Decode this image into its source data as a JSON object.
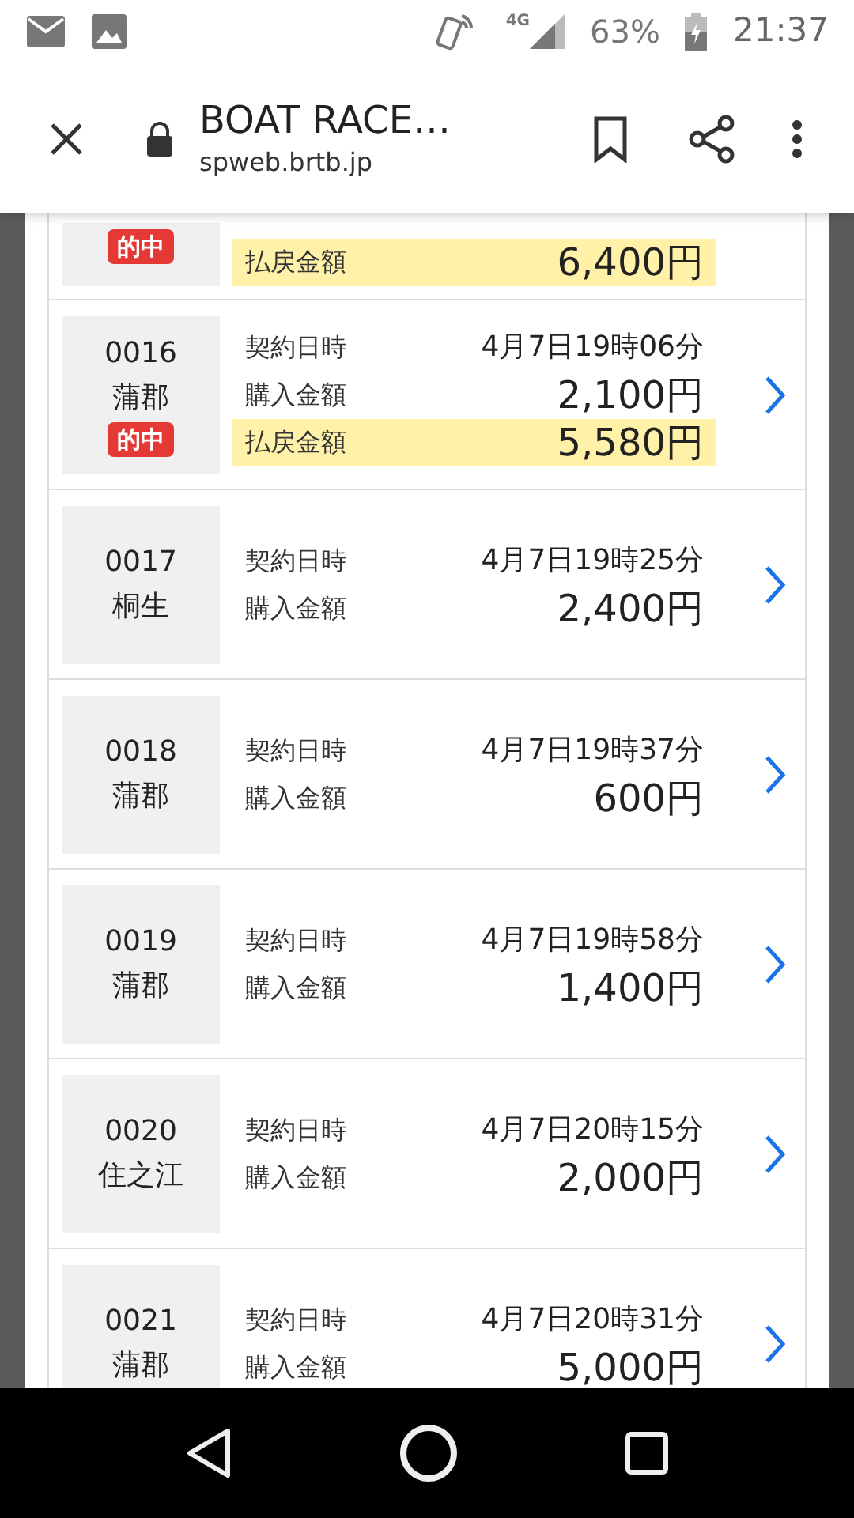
{
  "status_bar": {
    "network": "4G",
    "battery": "63%",
    "time": "21:37"
  },
  "browser": {
    "title": "BOAT RACE…",
    "url": "spweb.brtb.jp"
  },
  "cards": [
    {
      "kind": "clipped",
      "hit": true,
      "hit_label": "的中",
      "rows": [
        {
          "kind": "amount",
          "label": "払戻金額",
          "value": "6,400円",
          "highlight": true
        }
      ]
    },
    {
      "kind": "full",
      "number": "0016",
      "venue": "蒲郡",
      "hit": true,
      "hit_label": "的中",
      "rows": [
        {
          "kind": "date",
          "label": "契約日時",
          "value": "4月7日19時06分",
          "highlight": false
        },
        {
          "kind": "amount",
          "label": "購入金額",
          "value": "2,100円",
          "highlight": false
        },
        {
          "kind": "amount",
          "label": "払戻金額",
          "value": "5,580円",
          "highlight": true
        }
      ]
    },
    {
      "kind": "full",
      "number": "0017",
      "venue": "桐生",
      "hit": false,
      "rows": [
        {
          "kind": "date",
          "label": "契約日時",
          "value": "4月7日19時25分",
          "highlight": false
        },
        {
          "kind": "amount",
          "label": "購入金額",
          "value": "2,400円",
          "highlight": false
        }
      ]
    },
    {
      "kind": "full",
      "number": "0018",
      "venue": "蒲郡",
      "hit": false,
      "rows": [
        {
          "kind": "date",
          "label": "契約日時",
          "value": "4月7日19時37分",
          "highlight": false
        },
        {
          "kind": "amount",
          "label": "購入金額",
          "value": "600円",
          "highlight": false
        }
      ]
    },
    {
      "kind": "full",
      "number": "0019",
      "venue": "蒲郡",
      "hit": false,
      "rows": [
        {
          "kind": "date",
          "label": "契約日時",
          "value": "4月7日19時58分",
          "highlight": false
        },
        {
          "kind": "amount",
          "label": "購入金額",
          "value": "1,400円",
          "highlight": false
        }
      ]
    },
    {
      "kind": "full",
      "number": "0020",
      "venue": "住之江",
      "hit": false,
      "rows": [
        {
          "kind": "date",
          "label": "契約日時",
          "value": "4月7日20時15分",
          "highlight": false
        },
        {
          "kind": "amount",
          "label": "購入金額",
          "value": "2,000円",
          "highlight": false
        }
      ]
    },
    {
      "kind": "full",
      "number": "0021",
      "venue": "蒲郡",
      "hit": false,
      "rows": [
        {
          "kind": "date",
          "label": "契約日時",
          "value": "4月7日20時31分",
          "highlight": false
        },
        {
          "kind": "amount",
          "label": "購入金額",
          "value": "5,000円",
          "highlight": false
        }
      ]
    }
  ]
}
